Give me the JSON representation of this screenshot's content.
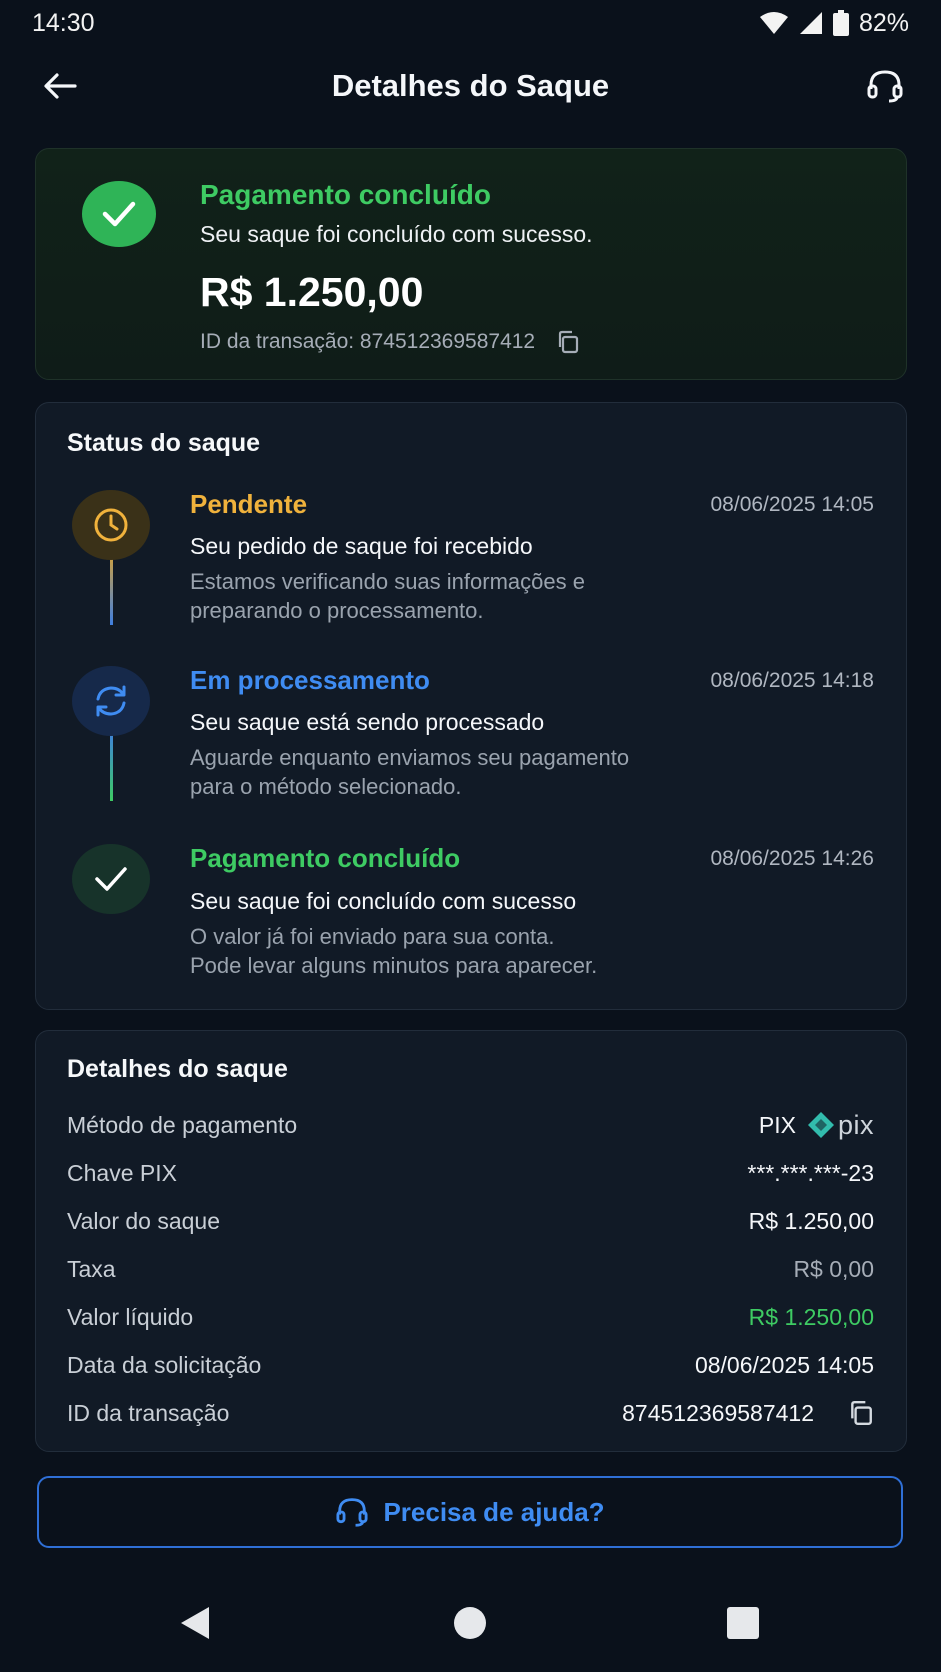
{
  "status_bar": {
    "time": "14:30",
    "battery": "82%"
  },
  "header": {
    "title": "Detalhes do Saque"
  },
  "success_card": {
    "title": "Pagamento concluído",
    "subtitle": "Seu saque foi concluído com sucesso.",
    "amount": "R$ 1.250,00",
    "transaction_label": "ID da transação: 874512369587412"
  },
  "status_card": {
    "heading": "Status do saque",
    "steps": [
      {
        "title": "Pendente",
        "date": "08/06/2025 14:05",
        "headline": "Seu pedido de saque foi recebido",
        "desc_line1": "Estamos verificando suas informações e",
        "desc_line2": "preparando o processamento.",
        "color": "#f0b23c",
        "icon": "clock-icon"
      },
      {
        "title": "Em processamento",
        "date": "08/06/2025 14:18",
        "headline": "Seu saque está sendo processado",
        "desc_line1": "Aguarde enquanto enviamos seu pagamento",
        "desc_line2": "para o método selecionado.",
        "color": "#3f8cf2",
        "icon": "refresh-icon"
      },
      {
        "title": "Pagamento concluído",
        "date": "08/06/2025 14:26",
        "headline": "Seu saque foi concluído com sucesso",
        "desc_line1": "O valor já foi enviado para sua conta.",
        "desc_line2": "Pode levar alguns minutos para aparecer.",
        "color": "#3ecb63",
        "icon": "check-icon"
      }
    ]
  },
  "details_card": {
    "heading": "Detalhes do saque",
    "rows": [
      {
        "label": "Método de pagamento",
        "value": "PIX"
      },
      {
        "label": "Chave PIX",
        "value": "***.***.***-23"
      },
      {
        "label": "Valor do saque",
        "value": "R$ 1.250,00"
      },
      {
        "label": "Taxa",
        "value": "R$ 0,00"
      },
      {
        "label": "Valor líquido",
        "value": "R$ 1.250,00"
      },
      {
        "label": "Data da solicitação",
        "value": "08/06/2025 14:05"
      },
      {
        "label": "ID da transação",
        "value": "874512369587412"
      }
    ],
    "pix_logo_text": "pix"
  },
  "help_button": {
    "label": "Precisa de ajuda?"
  },
  "colors": {
    "background": "#0a111b",
    "success": "#3ecb63",
    "pending": "#f0b23c",
    "processing": "#3f8cf2",
    "pix": "#32bcad"
  }
}
